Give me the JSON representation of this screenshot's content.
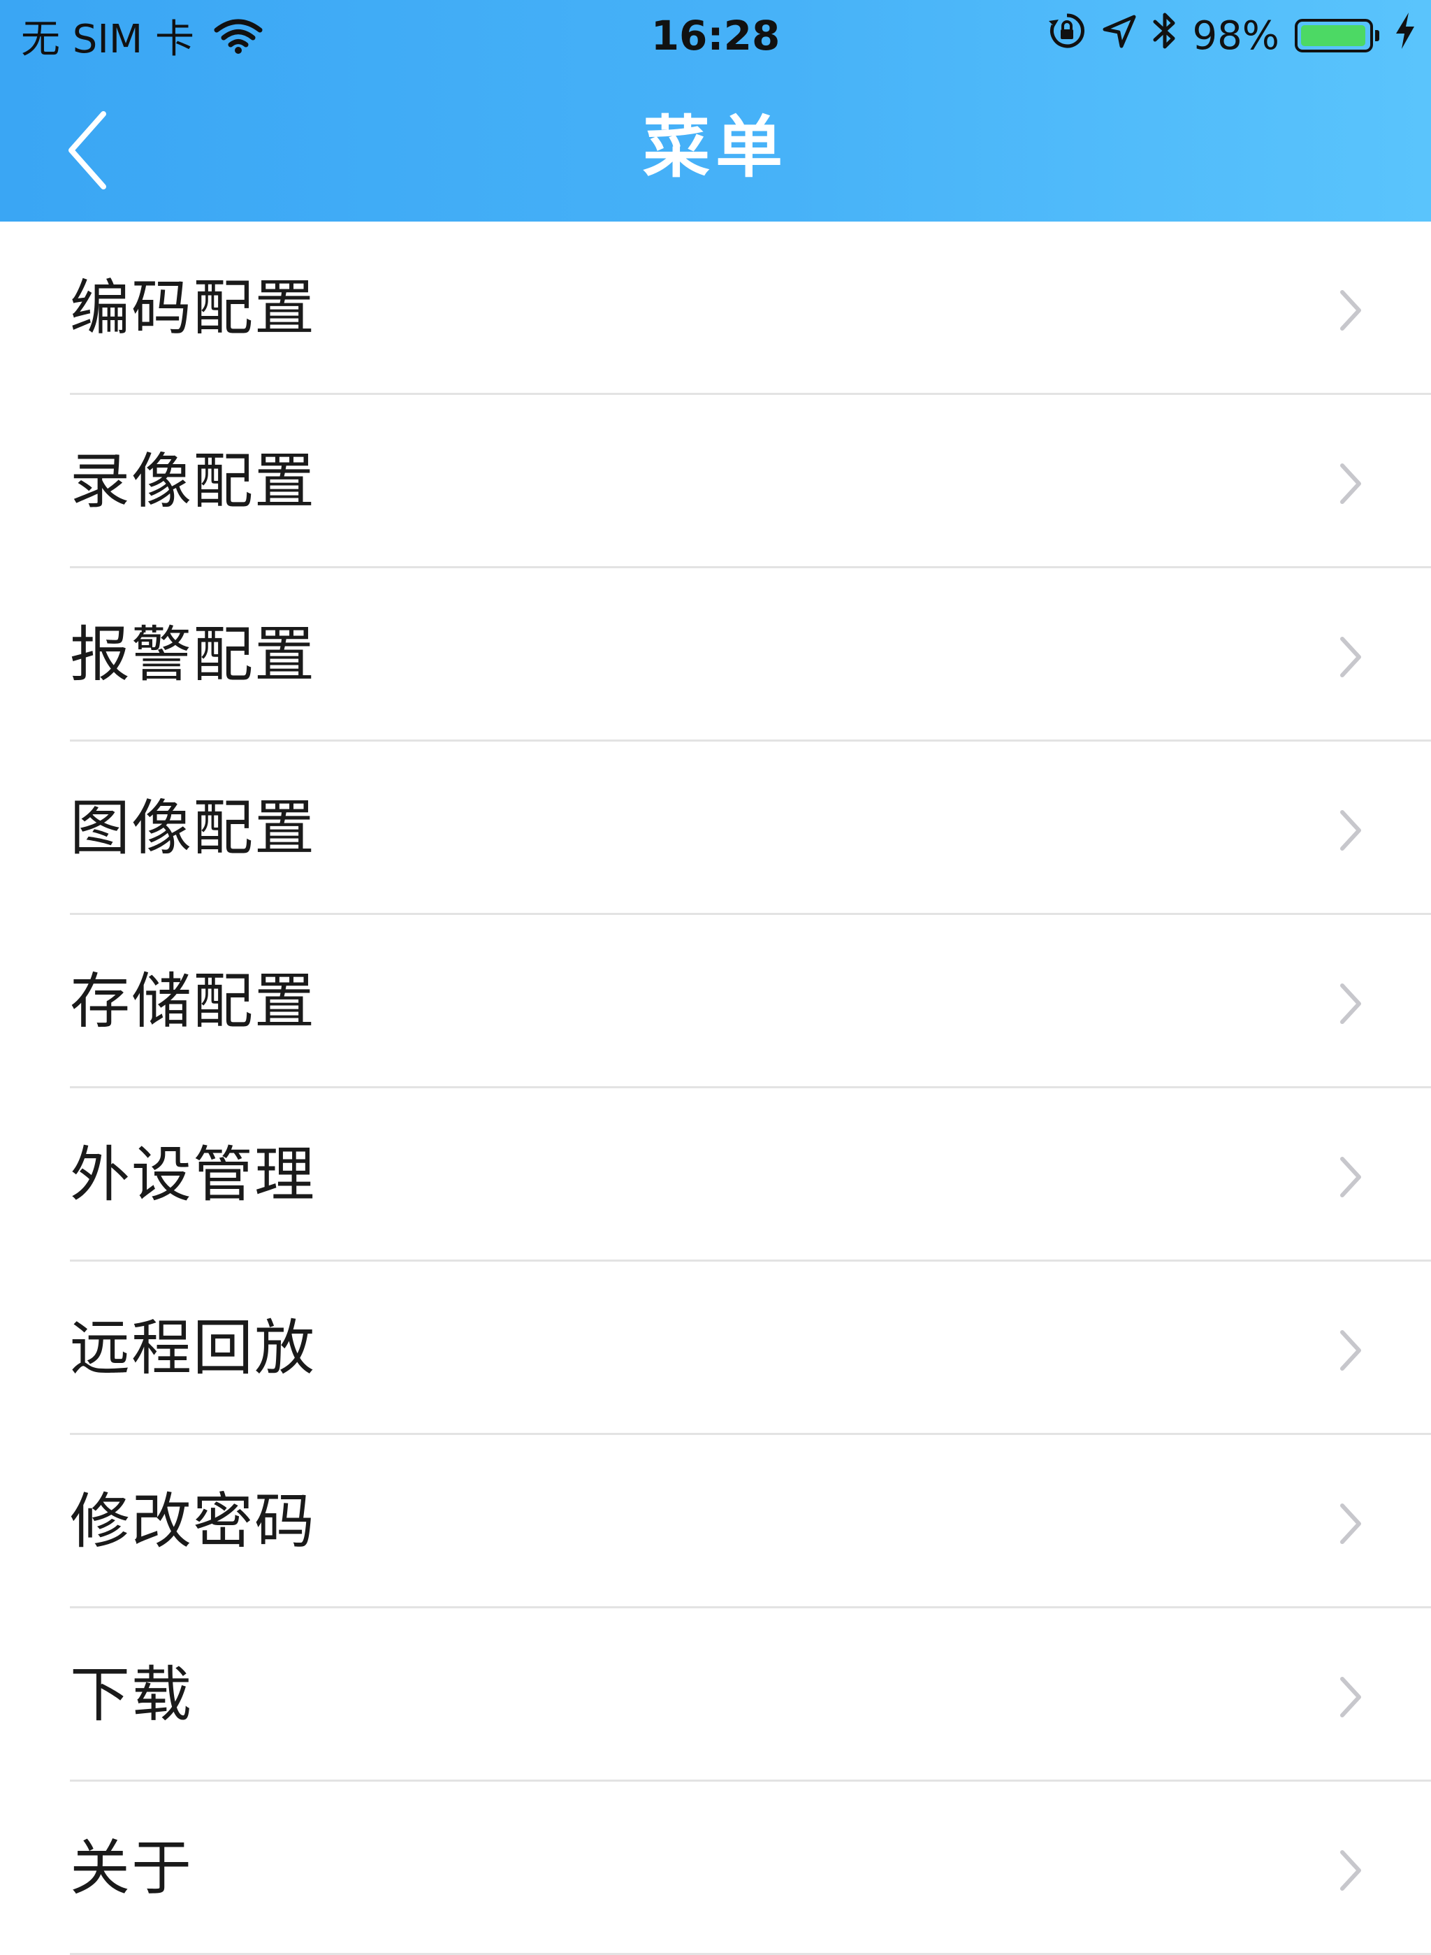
{
  "status_bar": {
    "carrier": "无 SIM 卡",
    "time": "16:28",
    "battery_percent": "98%",
    "battery_level": 0.98,
    "icons": [
      "wifi-icon",
      "rotation-lock-icon",
      "location-arrow-icon",
      "bluetooth-icon",
      "battery-icon",
      "charging-bolt-icon"
    ]
  },
  "navbar": {
    "title": "菜单",
    "back_icon": "chevron-left-icon"
  },
  "menu": {
    "items": [
      {
        "label": "编码配置"
      },
      {
        "label": "录像配置"
      },
      {
        "label": "报警配置"
      },
      {
        "label": "图像配置"
      },
      {
        "label": "存储配置"
      },
      {
        "label": "外设管理"
      },
      {
        "label": "远程回放"
      },
      {
        "label": "修改密码"
      },
      {
        "label": "下载"
      },
      {
        "label": "关于"
      }
    ],
    "chevron_icon": "chevron-right-icon"
  },
  "colors": {
    "header_gradient_start": "#3aa6f4",
    "header_gradient_end": "#5ac4fc",
    "divider": "#e3e3e3",
    "chevron": "#c7c7cc",
    "battery_fill": "#4cd964"
  }
}
